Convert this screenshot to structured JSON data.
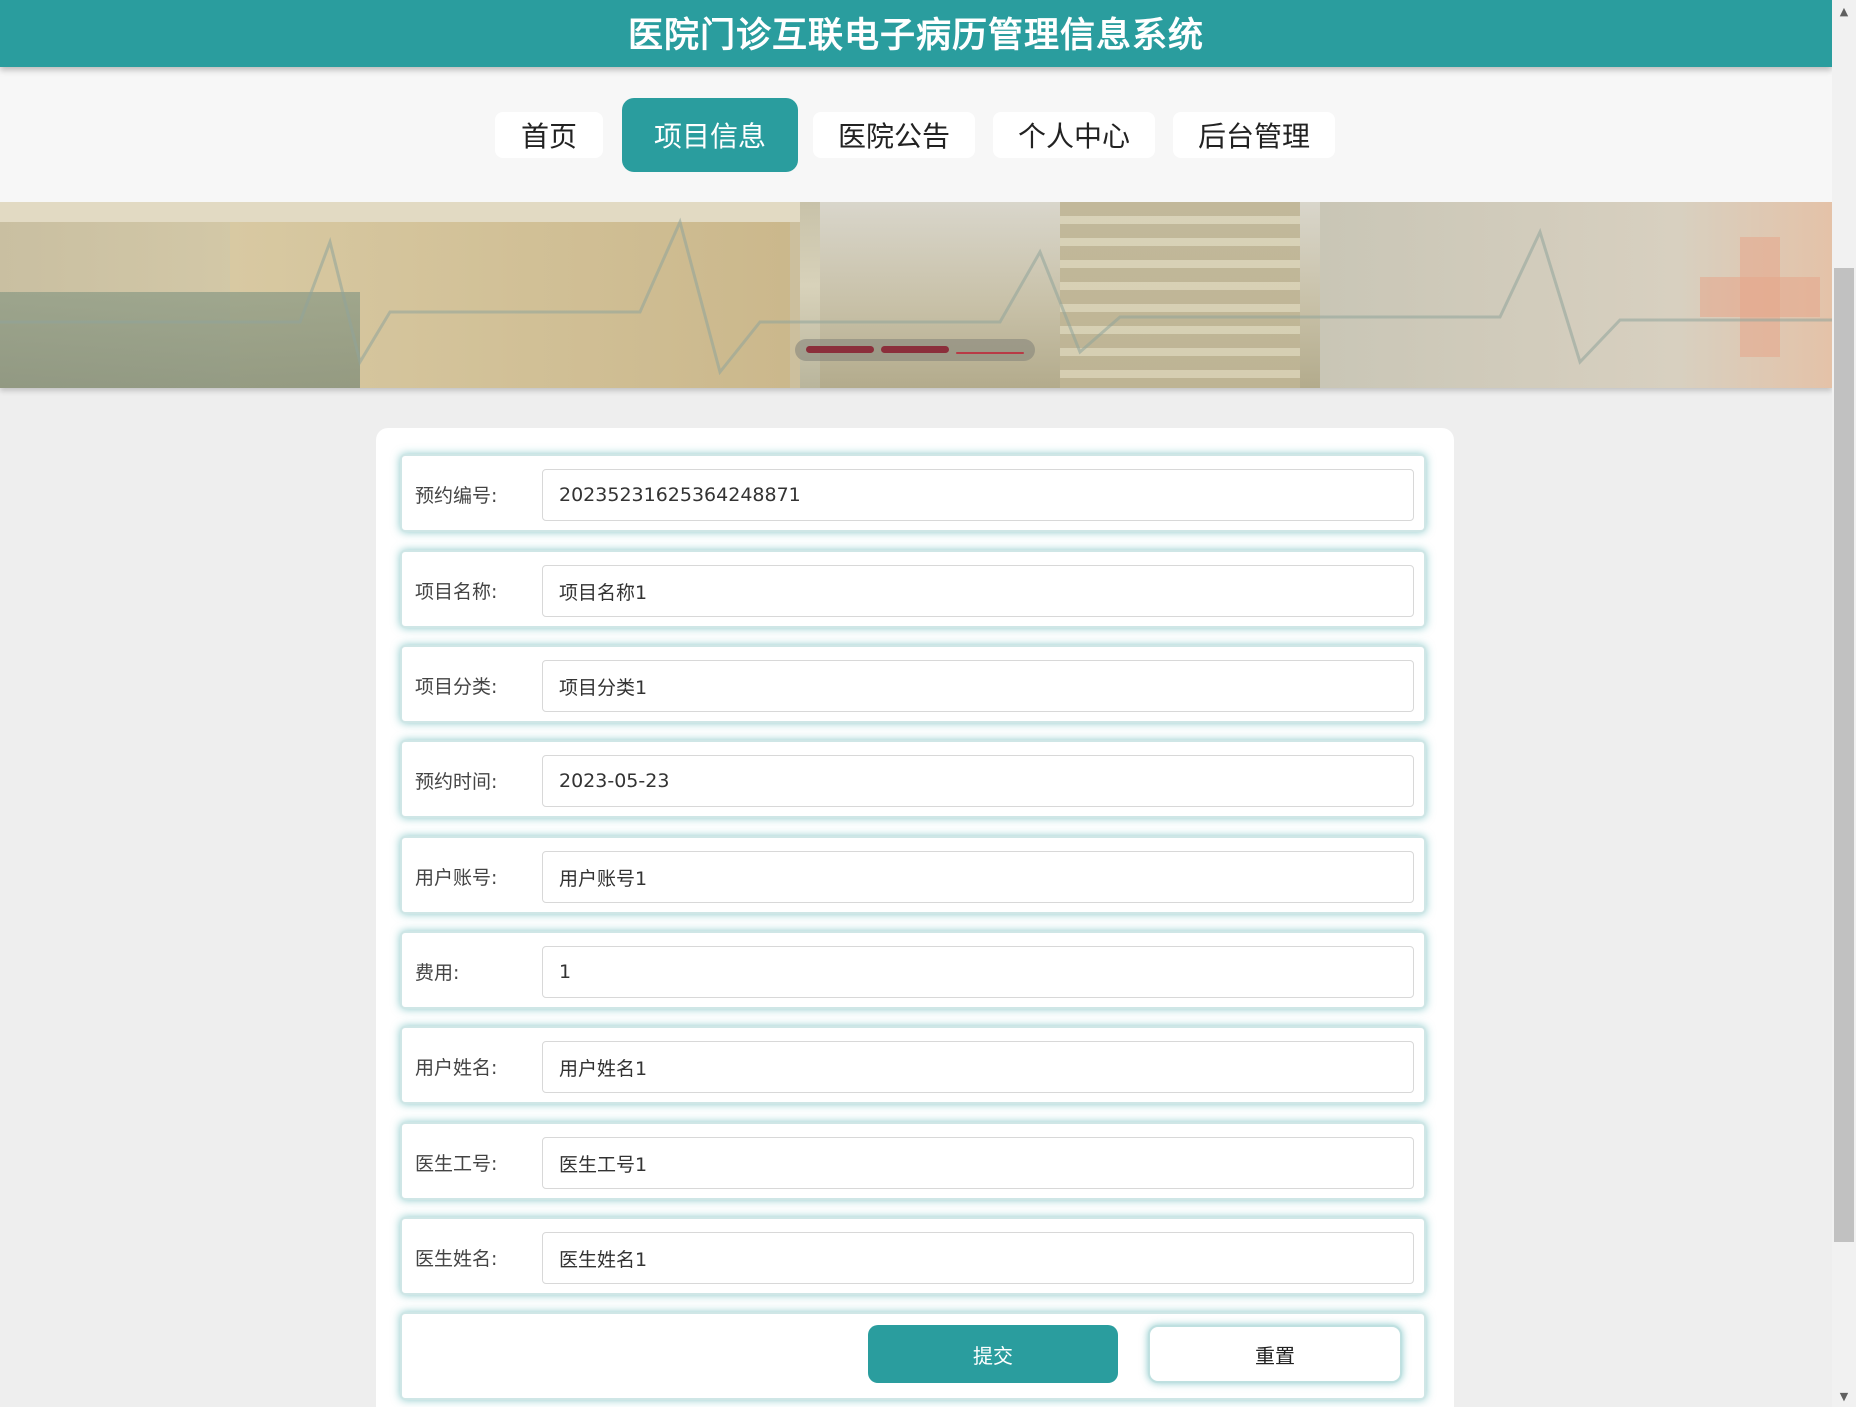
{
  "header": {
    "title": "医院门诊互联电子病历管理信息系统"
  },
  "nav": {
    "items": [
      {
        "label": "首页"
      },
      {
        "label": "项目信息"
      },
      {
        "label": "医院公告"
      },
      {
        "label": "个人中心"
      },
      {
        "label": "后台管理"
      }
    ],
    "active_index": 1
  },
  "banner": {
    "slide_count": 3,
    "active_slide": 3
  },
  "form": {
    "fields": [
      {
        "label": "预约编号:",
        "value": "20235231625364248871"
      },
      {
        "label": "项目名称:",
        "value": "项目名称1"
      },
      {
        "label": "项目分类:",
        "value": "项目分类1"
      },
      {
        "label": "预约时间:",
        "value": "2023-05-23"
      },
      {
        "label": "用户账号:",
        "value": "用户账号1"
      },
      {
        "label": "费用:",
        "value": "1"
      },
      {
        "label": "用户姓名:",
        "value": "用户姓名1"
      },
      {
        "label": "医生工号:",
        "value": "医生工号1"
      },
      {
        "label": "医生姓名:",
        "value": "医生姓名1"
      }
    ],
    "submit_label": "提交",
    "reset_label": "重置"
  },
  "colors": {
    "accent": "#2a9d9e",
    "banner_dot": "#8b2f3b",
    "page_bg": "#eeeeee"
  },
  "icons": {
    "scroll_up": "triangle-up-icon",
    "scroll_down": "triangle-down-icon"
  }
}
